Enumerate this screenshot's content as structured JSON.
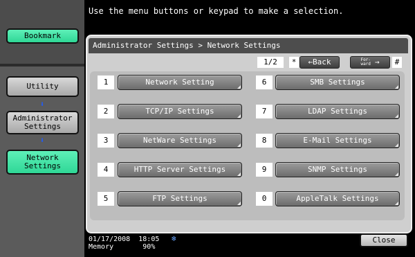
{
  "instruction": "Use the menu buttons or keypad to make a selection.",
  "sidebar": {
    "bookmark": "Bookmark",
    "utility": "Utility",
    "admin": [
      "Administrator",
      "Settings"
    ],
    "network": [
      "Network",
      "Settings"
    ]
  },
  "window": {
    "breadcrumb": "Administrator Settings > Network Settings",
    "page": "1/2",
    "back_key": "*",
    "back": "←Back",
    "forward_small": [
      "For-",
      "ward"
    ],
    "forward_arrow": "→",
    "forward_key": "#"
  },
  "menu": [
    {
      "num": "1",
      "label": "Network Setting"
    },
    {
      "num": "2",
      "label": "TCP/IP Settings"
    },
    {
      "num": "3",
      "label": "NetWare Settings"
    },
    {
      "num": "4",
      "label": "HTTP Server Settings"
    },
    {
      "num": "5",
      "label": "FTP Settings"
    },
    {
      "num": "6",
      "label": "SMB Settings"
    },
    {
      "num": "7",
      "label": "LDAP Settings"
    },
    {
      "num": "8",
      "label": "E-Mail Settings"
    },
    {
      "num": "9",
      "label": "SNMP Settings"
    },
    {
      "num": "0",
      "label": "AppleTalk Settings"
    }
  ],
  "status": {
    "date": "01/17/2008",
    "time": "18:05",
    "memory_label": "Memory",
    "memory_value": "90%",
    "icon": "network-status-icon"
  },
  "close": "Close",
  "colors": {
    "accent_green": "#2fd796",
    "arrow_blue": "#1f5cff"
  }
}
